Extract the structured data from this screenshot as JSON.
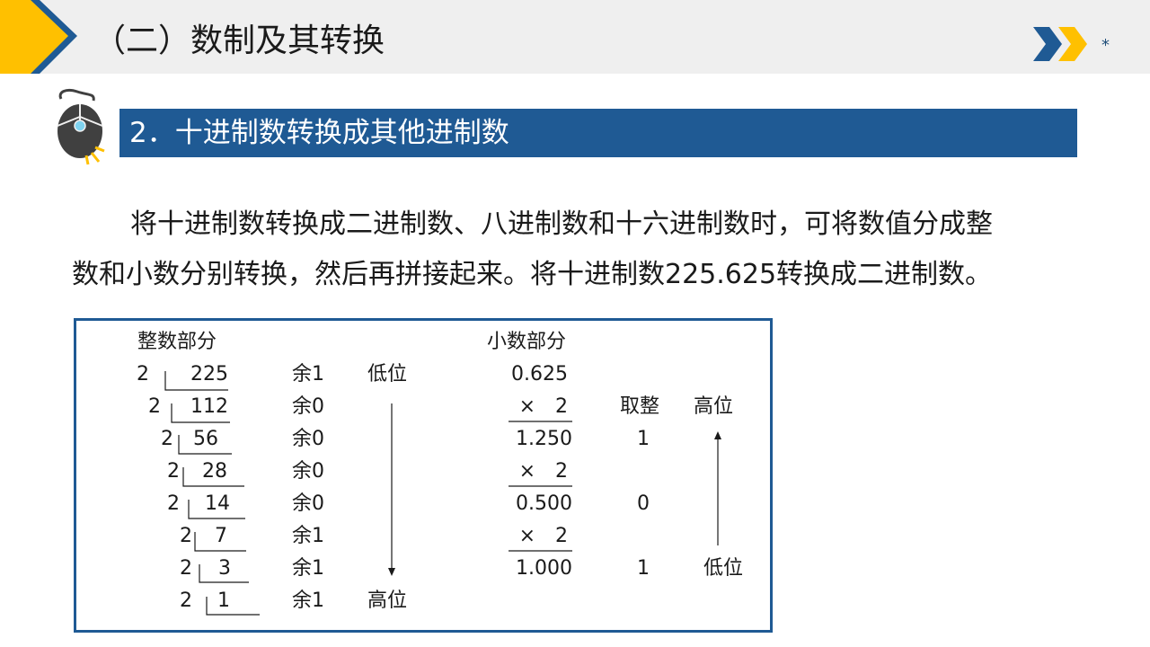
{
  "header": {
    "title": "（二）数制及其转换",
    "star": "*"
  },
  "section": {
    "title": "2．十进制数转换成其他进制数"
  },
  "paragraph": {
    "line1": "将十进制数转换成二进制数、八进制数和十六进制数时，可将数值分成整",
    "line2": "数和小数分别转换，然后再拼接起来。将十进制数225.625转换成二进制数。"
  },
  "integer_part": {
    "header": "整数部分",
    "divisor": "2",
    "remainder_prefix": "余",
    "rows": [
      {
        "dividend": "225",
        "remainder": "1"
      },
      {
        "dividend": "112",
        "remainder": "0"
      },
      {
        "dividend": "56",
        "remainder": "0"
      },
      {
        "dividend": "28",
        "remainder": "0"
      },
      {
        "dividend": "14",
        "remainder": "0"
      },
      {
        "dividend": "7",
        "remainder": "1"
      },
      {
        "dividend": "3",
        "remainder": "1"
      },
      {
        "dividend": "1",
        "remainder": "1"
      }
    ],
    "low_label": "低位",
    "high_label": "高位"
  },
  "fraction_part": {
    "header": "小数部分",
    "rows": [
      "0.625",
      "×　2",
      "1.250",
      "×　2",
      "0.500",
      "×　2",
      "1.000"
    ],
    "take_int_header": "取整",
    "take_int_values": [
      "1",
      "0",
      "1"
    ],
    "high_label": "高位",
    "low_label": "低位"
  },
  "colors": {
    "accent": "#1f5a94",
    "yellow": "#ffc000",
    "topbar": "#efefef"
  }
}
